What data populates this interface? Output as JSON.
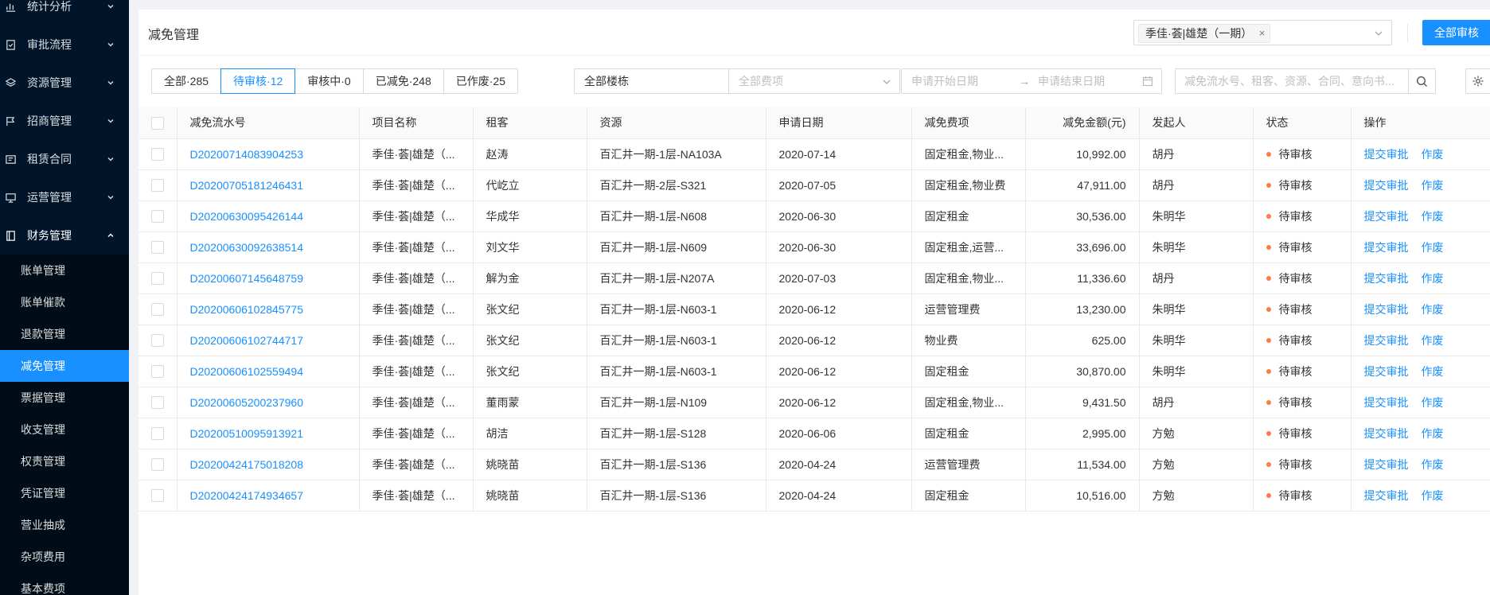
{
  "sidebar": {
    "groups": [
      {
        "label": "统计分析",
        "icon": "chart-icon"
      },
      {
        "label": "审批流程",
        "icon": "approval-icon"
      },
      {
        "label": "资源管理",
        "icon": "layers-icon"
      },
      {
        "label": "招商管理",
        "icon": "flag-icon"
      },
      {
        "label": "租赁合同",
        "icon": "contract-icon"
      },
      {
        "label": "运营管理",
        "icon": "monitor-icon"
      },
      {
        "label": "财务管理",
        "icon": "finance-icon"
      }
    ],
    "finance_items": [
      "账单管理",
      "账单催款",
      "退款管理",
      "减免管理",
      "票据管理",
      "收支管理",
      "权责管理",
      "凭证管理",
      "营业抽成",
      "杂项费用",
      "基本费项"
    ],
    "active_item": "减免管理"
  },
  "header": {
    "title": "减免管理",
    "project_tag": "季佳·荟|雄楚（一期）",
    "approve_all_label": "全部审核"
  },
  "filters": {
    "tabs": [
      "全部·285",
      "待审核·12",
      "审核中·0",
      "已减免·248",
      "已作废·25"
    ],
    "active_tab": "待审核·12",
    "building": "全部楼栋",
    "fee_item_placeholder": "全部费项",
    "start_date_placeholder": "申请开始日期",
    "end_date_placeholder": "申请结束日期",
    "search_placeholder": "减免流水号、租客、资源、合同、意向书..."
  },
  "table": {
    "columns": [
      "减免流水号",
      "项目名称",
      "租客",
      "资源",
      "申请日期",
      "减免费项",
      "减免金额(元)",
      "发起人",
      "状态",
      "操作"
    ],
    "rows": [
      {
        "id": "D20200714083904253",
        "project": "季佳·荟|雄楚（...",
        "tenant": "赵涛",
        "resource": "百汇井一期-1层-NA103A",
        "date": "2020-07-14",
        "fee": "固定租金,物业...",
        "amount": "10,992.00",
        "initiator": "胡丹",
        "status": "待审核",
        "op1": "提交审批",
        "op2": "作废"
      },
      {
        "id": "D20200705181246431",
        "project": "季佳·荟|雄楚（...",
        "tenant": "代屹立",
        "resource": "百汇井一期-2层-S321",
        "date": "2020-07-05",
        "fee": "固定租金,物业费",
        "amount": "47,911.00",
        "initiator": "胡丹",
        "status": "待审核",
        "op1": "提交审批",
        "op2": "作废"
      },
      {
        "id": "D20200630095426144",
        "project": "季佳·荟|雄楚（...",
        "tenant": "华成华",
        "resource": "百汇井一期-1层-N608",
        "date": "2020-06-30",
        "fee": "固定租金",
        "amount": "30,536.00",
        "initiator": "朱明华",
        "status": "待审核",
        "op1": "提交审批",
        "op2": "作废"
      },
      {
        "id": "D20200630092638514",
        "project": "季佳·荟|雄楚（...",
        "tenant": "刘文华",
        "resource": "百汇井一期-1层-N609",
        "date": "2020-06-30",
        "fee": "固定租金,运营...",
        "amount": "33,696.00",
        "initiator": "朱明华",
        "status": "待审核",
        "op1": "提交审批",
        "op2": "作废"
      },
      {
        "id": "D20200607145648759",
        "project": "季佳·荟|雄楚（...",
        "tenant": "解为金",
        "resource": "百汇井一期-1层-N207A",
        "date": "2020-07-03",
        "fee": "固定租金,物业...",
        "amount": "11,336.60",
        "initiator": "胡丹",
        "status": "待审核",
        "op1": "提交审批",
        "op2": "作废"
      },
      {
        "id": "D20200606102845775",
        "project": "季佳·荟|雄楚（...",
        "tenant": "张文纪",
        "resource": "百汇井一期-1层-N603-1",
        "date": "2020-06-12",
        "fee": "运营管理费",
        "amount": "13,230.00",
        "initiator": "朱明华",
        "status": "待审核",
        "op1": "提交审批",
        "op2": "作废"
      },
      {
        "id": "D20200606102744717",
        "project": "季佳·荟|雄楚（...",
        "tenant": "张文纪",
        "resource": "百汇井一期-1层-N603-1",
        "date": "2020-06-12",
        "fee": "物业费",
        "amount": "625.00",
        "initiator": "朱明华",
        "status": "待审核",
        "op1": "提交审批",
        "op2": "作废"
      },
      {
        "id": "D20200606102559494",
        "project": "季佳·荟|雄楚（...",
        "tenant": "张文纪",
        "resource": "百汇井一期-1层-N603-1",
        "date": "2020-06-12",
        "fee": "固定租金",
        "amount": "30,870.00",
        "initiator": "朱明华",
        "status": "待审核",
        "op1": "提交审批",
        "op2": "作废"
      },
      {
        "id": "D20200605200237960",
        "project": "季佳·荟|雄楚（...",
        "tenant": "董雨蒙",
        "resource": "百汇井一期-1层-N109",
        "date": "2020-06-12",
        "fee": "固定租金,物业...",
        "amount": "9,431.50",
        "initiator": "胡丹",
        "status": "待审核",
        "op1": "提交审批",
        "op2": "作废"
      },
      {
        "id": "D20200510095913921",
        "project": "季佳·荟|雄楚（...",
        "tenant": "胡洁",
        "resource": "百汇井一期-1层-S128",
        "date": "2020-06-06",
        "fee": "固定租金",
        "amount": "2,995.00",
        "initiator": "方勉",
        "status": "待审核",
        "op1": "提交审批",
        "op2": "作废"
      },
      {
        "id": "D20200424175018208",
        "project": "季佳·荟|雄楚（...",
        "tenant": "姚晓苗",
        "resource": "百汇井一期-1层-S136",
        "date": "2020-04-24",
        "fee": "运营管理费",
        "amount": "11,534.00",
        "initiator": "方勉",
        "status": "待审核",
        "op1": "提交审批",
        "op2": "作废"
      },
      {
        "id": "D20200424174934657",
        "project": "季佳·荟|雄楚（...",
        "tenant": "姚晓苗",
        "resource": "百汇井一期-1层-S136",
        "date": "2020-04-24",
        "fee": "固定租金",
        "amount": "10,516.00",
        "initiator": "方勉",
        "status": "待审核",
        "op1": "提交审批",
        "op2": "作废"
      }
    ]
  },
  "colors": {
    "primary": "#1890ff",
    "sidebar_bg": "#001529",
    "submenu_bg": "#000c17",
    "status_dot": "#ff7a45"
  }
}
